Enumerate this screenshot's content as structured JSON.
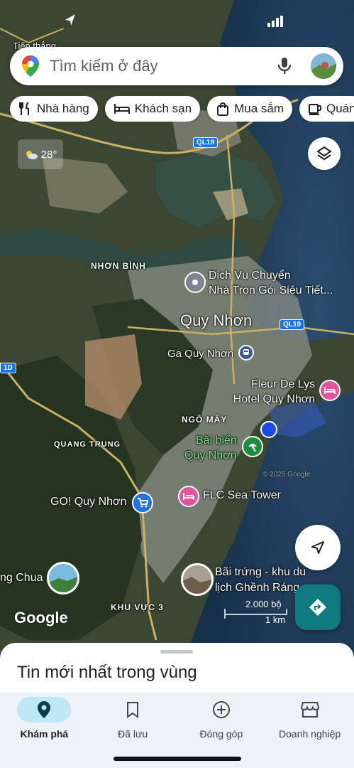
{
  "search": {
    "placeholder": "Tìm kiếm ở đây"
  },
  "chips": [
    "Nhà hàng",
    "Khách sạn",
    "Mua sắm",
    "Quán"
  ],
  "weather": {
    "temp": "28°"
  },
  "roads": {
    "ql19_a": "QL19",
    "ql19_b": "QL19",
    "ql1d": "1D"
  },
  "map_labels": {
    "top_partial": "Tiến thắng",
    "nhon_binh": "NHƠN BÌNH",
    "poi_dich_vu_line1": "Dịch Vụ Chuyển",
    "poi_dich_vu_line2": "Nhà Trọn Gói Siêu Tiết...",
    "city": "Quy Nhơn",
    "station": "Ga Quy Nhơn",
    "hotel_line1": "Fleur De Lys",
    "hotel_line2": "Hotel Quy Nhơn",
    "ngo_may": "NGÔ MÂY",
    "beach_line1": "Bãi biển",
    "beach_line2": "Quy Nhơn",
    "quang_trung": "QUANG TRUNG",
    "go": "GO! Quy Nhơn",
    "flc": "FLC Sea Tower",
    "chua": "ng Chua",
    "bai_trung_line1": "Bãi trứng - khu du",
    "bai_trung_line2": "lịch Ghềnh Ráng",
    "khu_vuc": "KHU VỰC 3",
    "copyright": "© 2025 Google"
  },
  "branding": {
    "google": "Google"
  },
  "scale": {
    "feet": "2.000 bộ",
    "km": "1 km"
  },
  "sheet": {
    "title": "Tin mới nhất trong vùng"
  },
  "bottom_nav": [
    {
      "label": "Khám phá",
      "icon": "location-pin-icon",
      "active": true
    },
    {
      "label": "Đã lưu",
      "icon": "bookmark-icon",
      "active": false
    },
    {
      "label": "Đóng góp",
      "icon": "add-circle-icon",
      "active": false
    },
    {
      "label": "Doanh nghiệp",
      "icon": "storefront-icon",
      "active": false
    }
  ],
  "colors": {
    "water": "#1f3a55",
    "land": "#3e4a38",
    "accent": "#1a73e8",
    "nav_active": "#bfe6f4",
    "directions": "#0f7a80"
  }
}
